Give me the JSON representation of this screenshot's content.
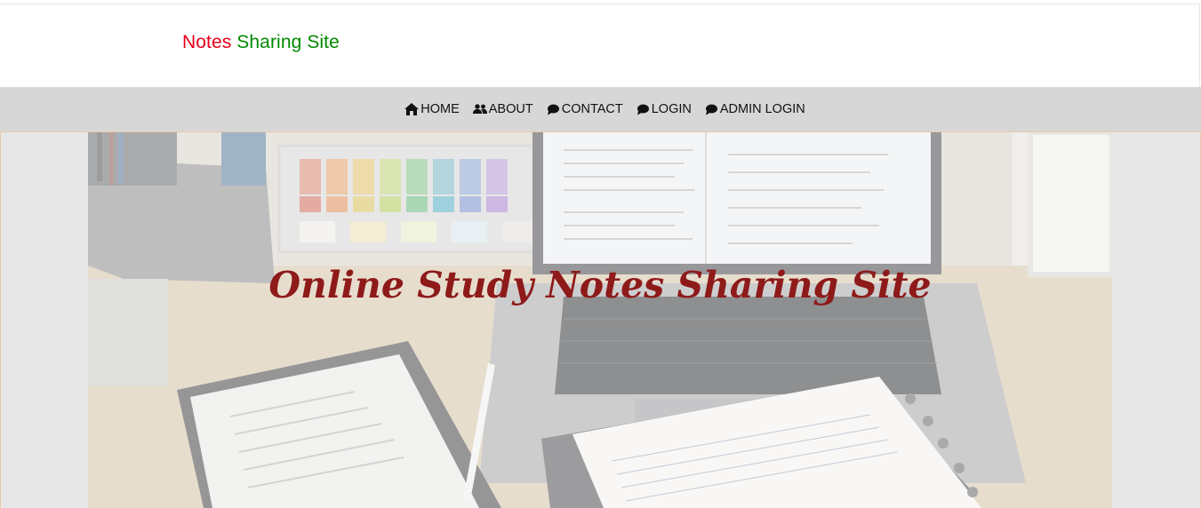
{
  "brand": {
    "word1": "Notes",
    "word2": "Sharing Site",
    "color1": "#e5001a",
    "color2": "#008a00"
  },
  "nav": {
    "items": [
      {
        "label": "HOME",
        "icon": "home-icon"
      },
      {
        "label": "ABOUT",
        "icon": "users-icon"
      },
      {
        "label": "CONTACT",
        "icon": "chat-icon"
      },
      {
        "label": "LOGIN",
        "icon": "chat-icon"
      },
      {
        "label": "ADMIN LOGIN",
        "icon": "chat-icon"
      }
    ]
  },
  "hero": {
    "title": "Online Study Notes Sharing Site",
    "title_color": "#8e1a1a"
  }
}
